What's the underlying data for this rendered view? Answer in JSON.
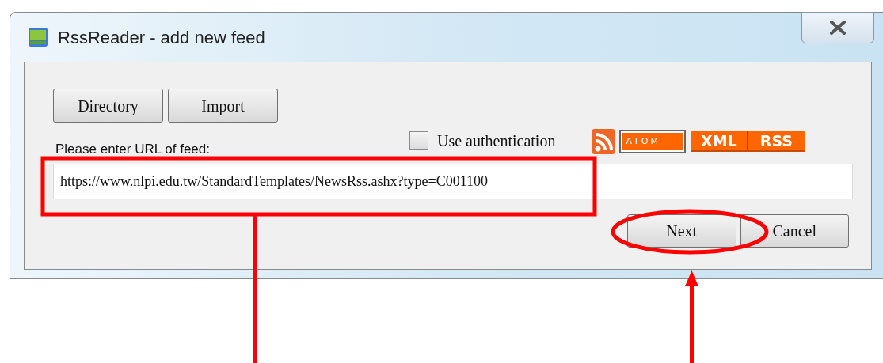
{
  "window": {
    "title": "RssReader - add new feed"
  },
  "toolbar_buttons": [
    "Directory",
    "Import"
  ],
  "authentication": {
    "label": "Use authentication",
    "checked": false
  },
  "feed_badges": [
    "ATOM",
    "XML",
    "RSS"
  ],
  "url_label": "Please enter URL of feed:",
  "url_field": {
    "value": "https://www.nlpi.edu.tw/StandardTemplates/NewsRss.ashx?type=C001100"
  },
  "buttons": [
    "Next",
    "Cancel"
  ]
}
